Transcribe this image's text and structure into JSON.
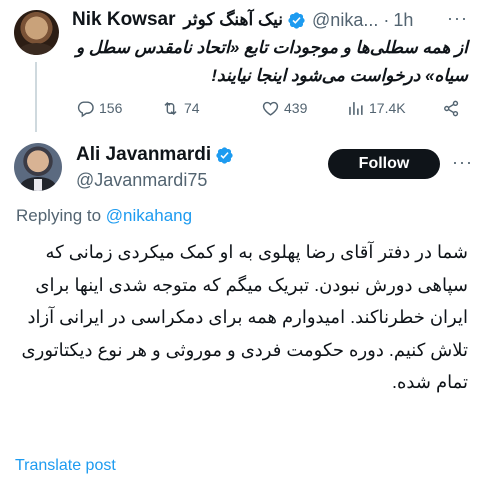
{
  "parent_tweet": {
    "author_name": "Nik Kowsar",
    "author_name_fa": "نیک آهنگ کوثر",
    "handle": "@nika...",
    "dot": "·",
    "time": "1h",
    "more": "···",
    "text": "از همه سطلی‌ها و موجودات تابع «اتحاد نامقدس سطل و سیاه» درخواست می‌شود اینجا نیایند!",
    "stats": {
      "replies": "156",
      "retweets": "74",
      "likes": "439",
      "views": "17.4K"
    }
  },
  "reply_tweet": {
    "author_name": "Ali Javanmardi",
    "handle": "@Javanmardi75",
    "follow_label": "Follow",
    "more": "···",
    "replying_prefix": "Replying to",
    "replying_to": "@nikahang",
    "text": "شما در دفتر آقای رضا پهلوی به او کمک میکردی زمانی که سپاهی دورش نبودن. تبریک میگم که متوجه شدی اینها برای ایران خطرناکند. امیدوارم همه برای دمکراسی در ایرانی آزاد تلاش کنیم. دوره حکومت فردی و موروثی و هر نوع دیکتاتوری تمام شده.",
    "translate_label": "Translate post"
  },
  "colors": {
    "accent": "#1d9bf0",
    "secondary_text": "#536471",
    "primary_text": "#0f1419"
  },
  "icons": [
    "verified-badge-icon",
    "reply-icon",
    "retweet-icon",
    "like-icon",
    "views-icon",
    "share-icon",
    "more-icon"
  ]
}
